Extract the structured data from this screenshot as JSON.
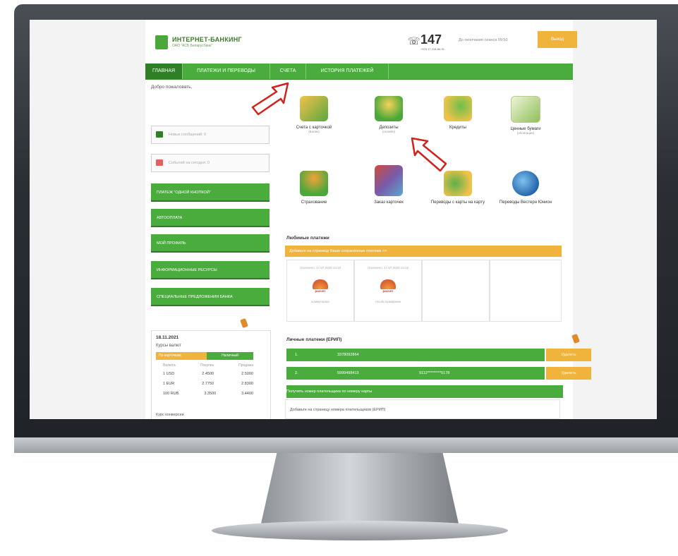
{
  "brand": {
    "title": "ИНТЕРНЕТ-БАНКИНГ",
    "subtitle": "ОАО \"АСБ Беларусбанк\""
  },
  "header": {
    "phone": "147",
    "phone_sub": "+375 17 218-84-31",
    "session": "До окончания сеанса 09:50",
    "logout": "Выход"
  },
  "nav": [
    {
      "label": "ГЛАВНАЯ",
      "active": true
    },
    {
      "label": "ПЛАТЕЖИ И ПЕРЕВОДЫ"
    },
    {
      "label": "СЧЕТА"
    },
    {
      "label": "ИСТОРИЯ ПЛАТЕЖЕЙ"
    }
  ],
  "sidebar": {
    "welcome": "Добро пожаловать,",
    "messages": "Новых сообщений: 0",
    "events": "Событий на сегодня: 0",
    "buttons": [
      "ПЛАТЕЖ \"ОДНОЙ КНОПКОЙ\"",
      "АВТООПЛАТА",
      "МОЙ ПРОФИЛЬ",
      "ИНФОРМАЦИОННЫЕ РЕСУРСЫ",
      "СПЕЦИАЛЬНЫЕ ПРЕДЛОЖЕНИЯ БАНКА"
    ]
  },
  "rates": {
    "date": "18.11.2021",
    "title": "Курсы валют",
    "tab_cards": "По карточкам",
    "tab_cash": "Наличный",
    "headers": [
      "Валюта",
      "Покупка",
      "Продажа"
    ],
    "rows": [
      [
        "1 USD",
        "2.4500",
        "2.5000"
      ],
      [
        "1 EUR",
        "2.7750",
        "2.8300"
      ],
      [
        "100 RUB",
        "3.3500",
        "3.4400"
      ]
    ],
    "conversion": "Курс конверсии"
  },
  "tiles": [
    {
      "label": "Счета с карточкой",
      "sub": "(Валик)"
    },
    {
      "label": "Депозиты",
      "sub": "(онлайн)"
    },
    {
      "label": "Кредиты",
      "sub": ""
    },
    {
      "label": "Ценные бумаги",
      "sub": "(облигации)"
    },
    {
      "label": "Страхование",
      "sub": ""
    },
    {
      "label": "Заказ карточек",
      "sub": ""
    },
    {
      "label": "Переводы с карты на карту",
      "sub": ""
    },
    {
      "label": "Переводы Вестерн Юнион",
      "sub": ""
    }
  ],
  "favorites": {
    "title": "Любимые платежи",
    "bar": "Добавьте на страницу Ваши сохранённые платежи >>",
    "cards": [
      {
        "paid": "Оплачено: 17.07.2020 13:15",
        "name": "коммуналка",
        "logo": "расчет"
      },
      {
        "paid": "Оплачено: 17.07.2020 13:16",
        "name": "техобслуживание",
        "logo": "расчет"
      }
    ]
  },
  "personal": {
    "title": "Личные платежи (ЕРИП)",
    "rows": [
      {
        "n": "1.",
        "code": "3378092864",
        "card": "",
        "del": "Удалить"
      },
      {
        "n": "2.",
        "code": "5999498413",
        "card": "9112*********5178",
        "del": "Удалить"
      }
    ],
    "bar": "Получить номер плательщика по номеру карты",
    "add_text": "Добавьте на страницу номера плательщиков (ЕРИП)"
  }
}
